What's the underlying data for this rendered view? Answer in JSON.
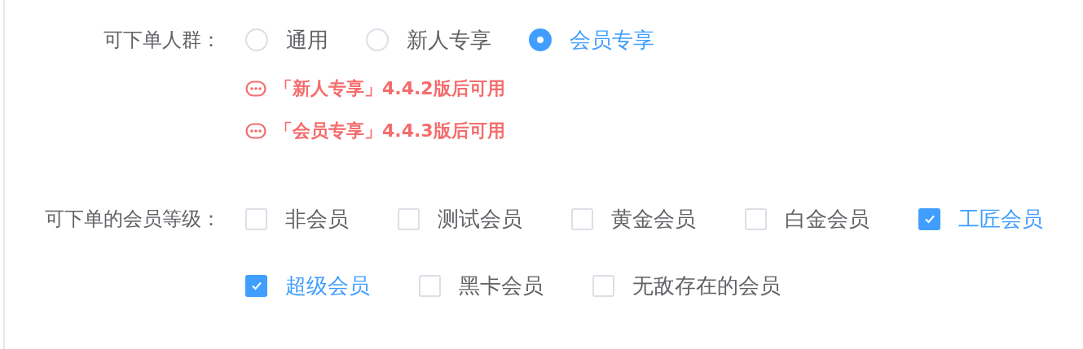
{
  "audience": {
    "label": "可下单人群：",
    "options": [
      {
        "label": "通用",
        "selected": false
      },
      {
        "label": "新人专享",
        "selected": false
      },
      {
        "label": "会员专享",
        "selected": true
      }
    ],
    "notes": [
      "「新人专享」4.4.2版后可用",
      "「会员专享」4.4.3版后可用"
    ]
  },
  "member_levels": {
    "label": "可下单的会员等级：",
    "options": [
      {
        "label": "非会员",
        "checked": false
      },
      {
        "label": "测试会员",
        "checked": false
      },
      {
        "label": "黄金会员",
        "checked": false
      },
      {
        "label": "白金会员",
        "checked": false
      },
      {
        "label": "工匠会员",
        "checked": true
      },
      {
        "label": "超级会员",
        "checked": true
      },
      {
        "label": "黑卡会员",
        "checked": false
      },
      {
        "label": "无敌存在的会员",
        "checked": false
      }
    ]
  }
}
